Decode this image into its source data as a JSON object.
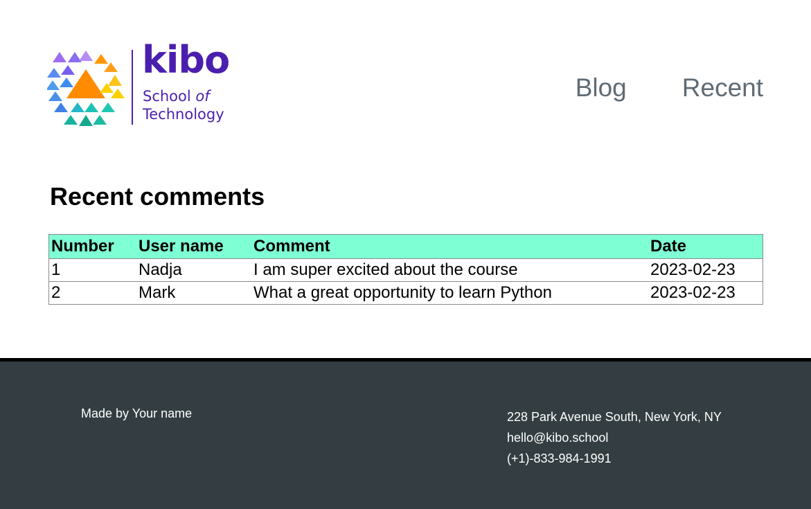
{
  "header": {
    "logo": {
      "word": "kibo",
      "line1": "School",
      "line1_suffix": "of",
      "line2": "Technology"
    },
    "nav": [
      {
        "label": "Blog"
      },
      {
        "label": "Recent"
      }
    ]
  },
  "main": {
    "title": "Recent comments",
    "table": {
      "headers": [
        "Number",
        "User name",
        "Comment",
        "Date"
      ],
      "rows": [
        [
          "1",
          "Nadja",
          "I am super excited about the course",
          "2023-02-23"
        ],
        [
          "2",
          "Mark",
          "What a great opportunity to learn Python",
          "2023-02-23"
        ]
      ]
    }
  },
  "footer": {
    "made_by": "Made by Your name",
    "address": "228 Park Avenue South, New York, NY",
    "email": "hello@kibo.school",
    "phone": "(+1)-833-984-1991"
  },
  "colors": {
    "brand_purple": "#4b1fae",
    "table_header_bg": "#7fffd4",
    "footer_bg": "#343e42",
    "nav_text": "#5f6b74"
  }
}
